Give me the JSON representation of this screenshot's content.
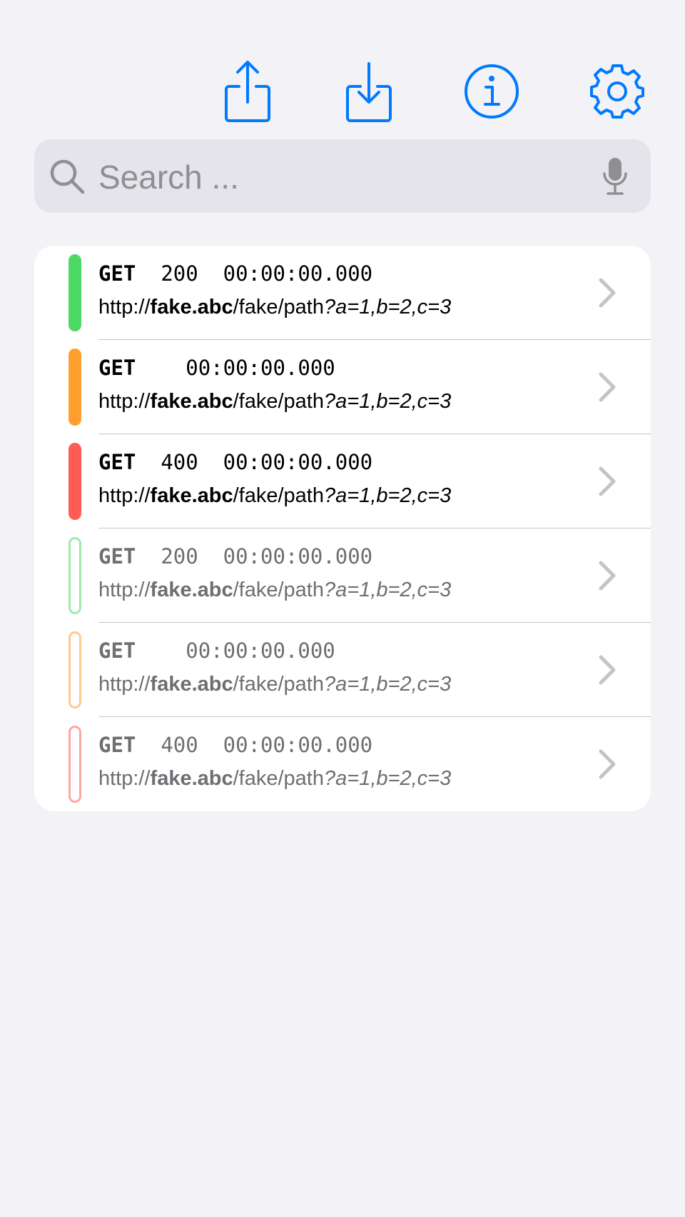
{
  "colors": {
    "accent": "#007aff",
    "success": "#4cd964",
    "pending": "#ff9f2e",
    "error": "#ff5c55"
  },
  "toolbar": {
    "icons": [
      "share-icon",
      "download-icon",
      "info-icon",
      "gear-icon"
    ]
  },
  "search": {
    "placeholder": "Search ...",
    "value": ""
  },
  "requests": [
    {
      "method": "GET",
      "status": "200",
      "time": "00:00:00.000",
      "scheme": "http://",
      "host": "fake.abc",
      "path": "/fake/path",
      "query": "?a=1,b=2,c=3",
      "status_color": "success",
      "bar_style": "filled"
    },
    {
      "method": "GET",
      "status": "",
      "time": "00:00:00.000",
      "scheme": "http://",
      "host": "fake.abc",
      "path": "/fake/path",
      "query": "?a=1,b=2,c=3",
      "status_color": "pending",
      "bar_style": "filled"
    },
    {
      "method": "GET",
      "status": "400",
      "time": "00:00:00.000",
      "scheme": "http://",
      "host": "fake.abc",
      "path": "/fake/path",
      "query": "?a=1,b=2,c=3",
      "status_color": "error",
      "bar_style": "filled"
    },
    {
      "method": "GET",
      "status": "200",
      "time": "00:00:00.000",
      "scheme": "http://",
      "host": "fake.abc",
      "path": "/fake/path",
      "query": "?a=1,b=2,c=3",
      "status_color": "success",
      "bar_style": "outline"
    },
    {
      "method": "GET",
      "status": "",
      "time": "00:00:00.000",
      "scheme": "http://",
      "host": "fake.abc",
      "path": "/fake/path",
      "query": "?a=1,b=2,c=3",
      "status_color": "pending",
      "bar_style": "outline"
    },
    {
      "method": "GET",
      "status": "400",
      "time": "00:00:00.000",
      "scheme": "http://",
      "host": "fake.abc",
      "path": "/fake/path",
      "query": "?a=1,b=2,c=3",
      "status_color": "error",
      "bar_style": "outline"
    }
  ]
}
